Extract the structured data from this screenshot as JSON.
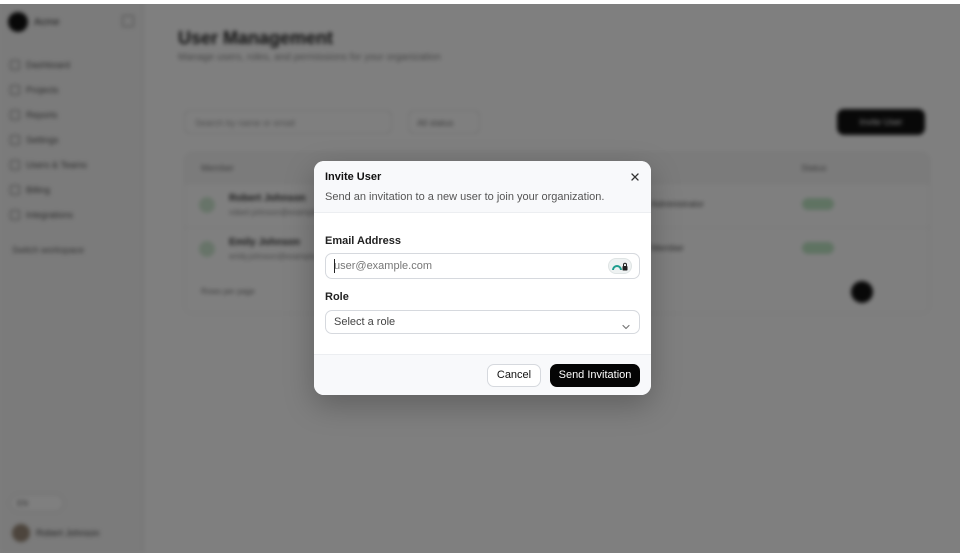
{
  "colors": {
    "overlay": "#000000",
    "primary_button": "#050505",
    "status_active": "#bfe6c5"
  },
  "background": {
    "sidebar": {
      "brand_name": "Acme",
      "brand_logo_icon": "brand-logo",
      "nav_items": [
        {
          "label": "Dashboard",
          "icon": "home-icon"
        },
        {
          "label": "Projects",
          "icon": "folder-icon"
        },
        {
          "label": "Reports",
          "icon": "chart-icon"
        },
        {
          "label": "Settings",
          "icon": "gear-icon"
        },
        {
          "label": "Users & Teams",
          "icon": "users-icon"
        },
        {
          "label": "Billing",
          "icon": "card-icon"
        },
        {
          "label": "Integrations",
          "icon": "plug-icon"
        }
      ],
      "switch_org_label": "Switch workspace",
      "language_label": "EN",
      "user_name": "Robert Johnson"
    },
    "main": {
      "title": "User Management",
      "subtitle": "Manage users, roles, and permissions for your organization",
      "search_placeholder": "Search by name or email",
      "status_filter": "All status",
      "invite_button": "Invite User",
      "columns": {
        "member": "Member",
        "status": "Status"
      },
      "rows": [
        {
          "name": "Robert Johnson",
          "email": "robert.johnson@example.com",
          "role": "Administrator"
        },
        {
          "name": "Emily Johnson",
          "email": "emily.johnson@example.com",
          "role": "Member"
        }
      ],
      "rows_per_page_label": "Rows per page"
    }
  },
  "dialog": {
    "title": "Invite User",
    "description": "Send an invitation to a new user to join your organization.",
    "close_icon": "close-icon",
    "email_label": "Email Address",
    "email_placeholder": "user@example.com",
    "email_value": "",
    "password_manager_icon": "password-manager-icon",
    "role_label": "Role",
    "role_placeholder": "Select a role",
    "role_chevron_icon": "chevron-down-icon",
    "cancel_label": "Cancel",
    "send_label": "Send Invitation"
  }
}
